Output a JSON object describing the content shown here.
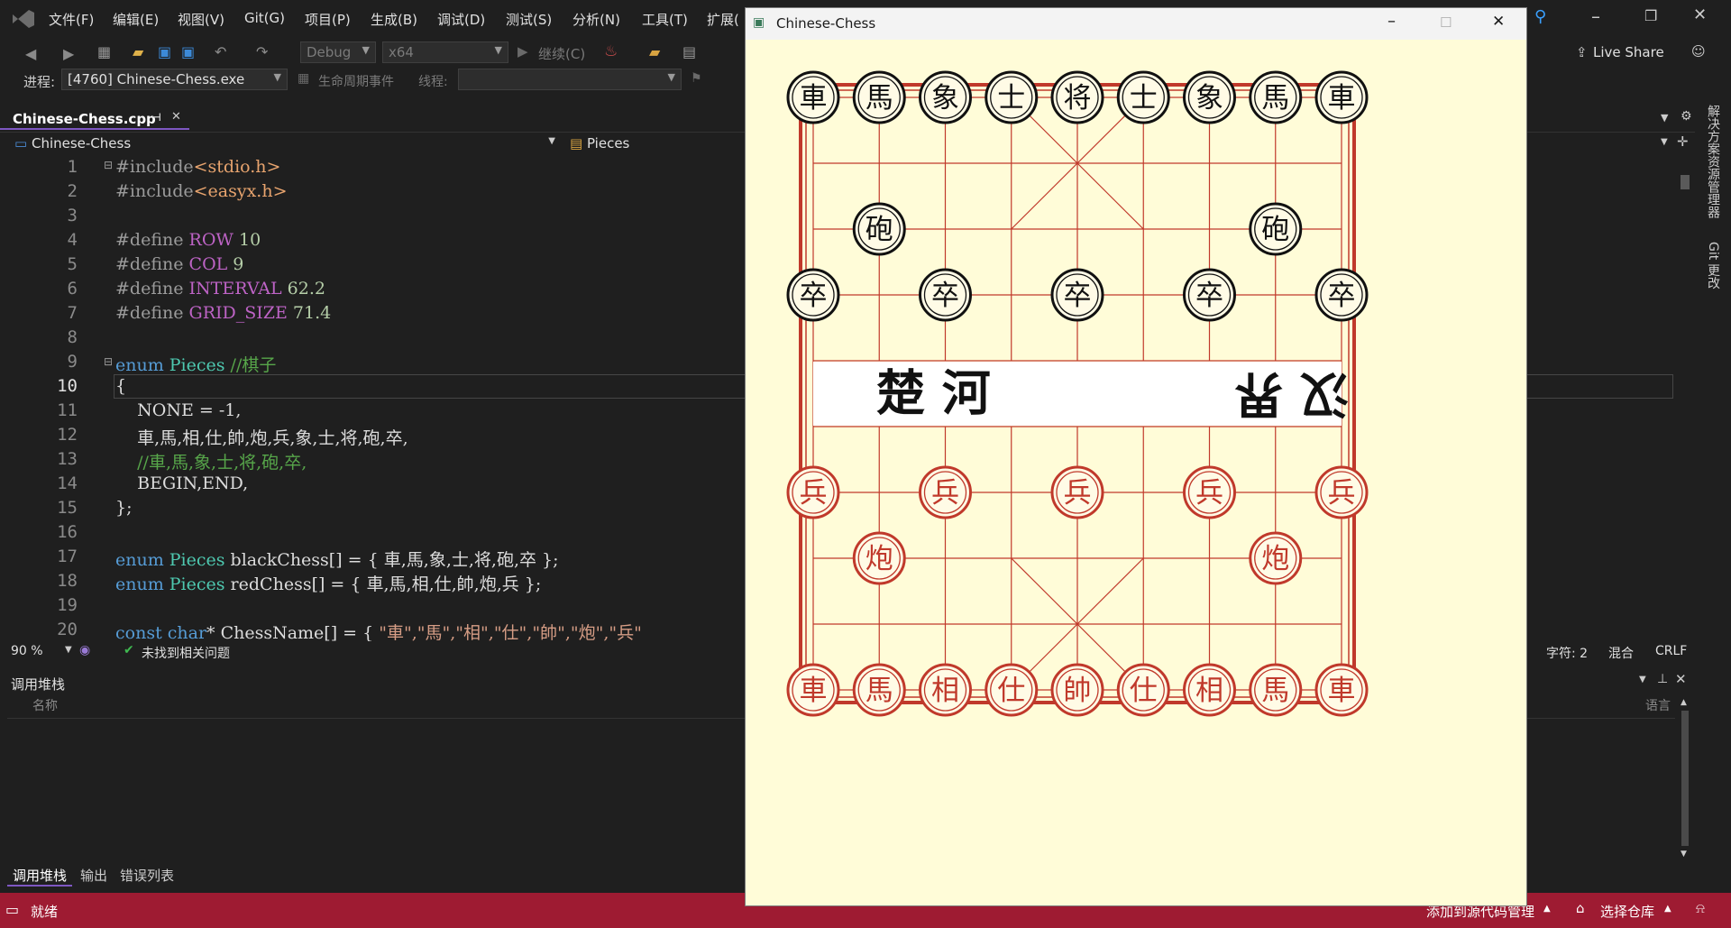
{
  "menubar": {
    "items": [
      "文件(F)",
      "编辑(E)",
      "视图(V)",
      "Git(G)",
      "项目(P)",
      "生成(B)",
      "调试(D)",
      "测试(S)",
      "分析(N)",
      "工具(T)",
      "扩展("
    ],
    "live_share": "Live Share"
  },
  "toolbar": {
    "config": "Debug",
    "platform": "x64",
    "continue_label": "继续(C)"
  },
  "procbar": {
    "process_label": "进程:",
    "process_value": "[4760] Chinese-Chess.exe",
    "lifecycle_label": "生命周期事件",
    "thread_label": "线程:"
  },
  "tabs": {
    "active_file": "Chinese-Chess.cpp"
  },
  "nav": {
    "project": "Chinese-Chess",
    "member": "Pieces"
  },
  "editor": {
    "line_numbers": [
      "1",
      "2",
      "3",
      "4",
      "5",
      "6",
      "7",
      "8",
      "9",
      "10",
      "11",
      "12",
      "13",
      "14",
      "15",
      "16",
      "17",
      "18",
      "19",
      "20"
    ],
    "lines": {
      "l1_kw": "#include",
      "l1_file": "<stdio.h>",
      "l2_kw": "#include",
      "l2_file": "<easyx.h>",
      "l4_def": "#define ",
      "l4_name": "ROW",
      "l4_val": " 10",
      "l5_def": "#define ",
      "l5_name": "COL",
      "l5_val": " 9",
      "l6_def": "#define ",
      "l6_name": "INTERVAL",
      "l6_val": " 62.2",
      "l7_def": "#define ",
      "l7_name": "GRID_SIZE",
      "l7_val": " 71.4",
      "l9_kw": "enum",
      "l9_type": " Pieces",
      "l9_cm": " //棋子",
      "l10": "{",
      "l11": "    NONE = -1,",
      "l12": "    車,馬,相,仕,帥,炮,兵,象,士,将,砲,卒,",
      "l13": "    //車,馬,象,士,将,砲,卒,",
      "l14": "    BEGIN,END,",
      "l15": "};",
      "l17_kw": "enum",
      "l17_type": " Pieces",
      "l17_rest": " blackChess[] = { 車,馬,象,士,将,砲,卒 };",
      "l18_kw": "enum",
      "l18_type": " Pieces",
      "l18_rest": " redChess[] = { 車,馬,相,仕,帥,炮,兵 };",
      "l20_kw": "const",
      "l20_kw2": " char",
      "l20_rest": "* ChessName[] = { ",
      "l20_str": "\"車\",\"馬\",\"相\",\"仕\",\"帥\",\"炮\",\"兵\""
    }
  },
  "status_mid": {
    "zoom": "90 %",
    "issues": "未找到相关问题",
    "char": "字符: 2",
    "mixed": "混合",
    "eol": "CRLF"
  },
  "callstack": {
    "title": "调用堆栈",
    "name_col": "名称",
    "lang_col": "语言"
  },
  "bottom_tabs": [
    "调用堆栈",
    "输出",
    "错误列表"
  ],
  "statusbar": {
    "ready": "就绪",
    "add_source": "添加到源代码管理",
    "select_repo": "选择仓库"
  },
  "right_strip": {
    "solution_explorer": "解决方案资源管理器",
    "git_changes": "Git 更改"
  },
  "chess_window": {
    "title": "Chinese-Chess",
    "river_left": "楚 河",
    "river_right": "汉 界",
    "pieces": [
      {
        "c": "車",
        "col": 0,
        "row": 0,
        "side": "black"
      },
      {
        "c": "馬",
        "col": 1,
        "row": 0,
        "side": "black"
      },
      {
        "c": "象",
        "col": 2,
        "row": 0,
        "side": "black"
      },
      {
        "c": "士",
        "col": 3,
        "row": 0,
        "side": "black"
      },
      {
        "c": "将",
        "col": 4,
        "row": 0,
        "side": "black"
      },
      {
        "c": "士",
        "col": 5,
        "row": 0,
        "side": "black"
      },
      {
        "c": "象",
        "col": 6,
        "row": 0,
        "side": "black"
      },
      {
        "c": "馬",
        "col": 7,
        "row": 0,
        "side": "black"
      },
      {
        "c": "車",
        "col": 8,
        "row": 0,
        "side": "black"
      },
      {
        "c": "砲",
        "col": 1,
        "row": 2,
        "side": "black"
      },
      {
        "c": "砲",
        "col": 7,
        "row": 2,
        "side": "black"
      },
      {
        "c": "卒",
        "col": 0,
        "row": 3,
        "side": "black"
      },
      {
        "c": "卒",
        "col": 2,
        "row": 3,
        "side": "black"
      },
      {
        "c": "卒",
        "col": 4,
        "row": 3,
        "side": "black"
      },
      {
        "c": "卒",
        "col": 6,
        "row": 3,
        "side": "black"
      },
      {
        "c": "卒",
        "col": 8,
        "row": 3,
        "side": "black"
      },
      {
        "c": "兵",
        "col": 0,
        "row": 6,
        "side": "red"
      },
      {
        "c": "兵",
        "col": 2,
        "row": 6,
        "side": "red"
      },
      {
        "c": "兵",
        "col": 4,
        "row": 6,
        "side": "red"
      },
      {
        "c": "兵",
        "col": 6,
        "row": 6,
        "side": "red"
      },
      {
        "c": "兵",
        "col": 8,
        "row": 6,
        "side": "red"
      },
      {
        "c": "炮",
        "col": 1,
        "row": 7,
        "side": "red"
      },
      {
        "c": "炮",
        "col": 7,
        "row": 7,
        "side": "red"
      },
      {
        "c": "車",
        "col": 0,
        "row": 9,
        "side": "red"
      },
      {
        "c": "馬",
        "col": 1,
        "row": 9,
        "side": "red"
      },
      {
        "c": "相",
        "col": 2,
        "row": 9,
        "side": "red"
      },
      {
        "c": "仕",
        "col": 3,
        "row": 9,
        "side": "red"
      },
      {
        "c": "帥",
        "col": 4,
        "row": 9,
        "side": "red"
      },
      {
        "c": "仕",
        "col": 5,
        "row": 9,
        "side": "red"
      },
      {
        "c": "相",
        "col": 6,
        "row": 9,
        "side": "red"
      },
      {
        "c": "馬",
        "col": 7,
        "row": 9,
        "side": "red"
      },
      {
        "c": "車",
        "col": 8,
        "row": 9,
        "side": "red"
      }
    ]
  },
  "colors": {
    "board_bg": "#fffcd8",
    "board_line": "#c0392b",
    "black_piece": "#111111",
    "red_piece": "#c0392b",
    "status_bar": "#9e1b32"
  }
}
